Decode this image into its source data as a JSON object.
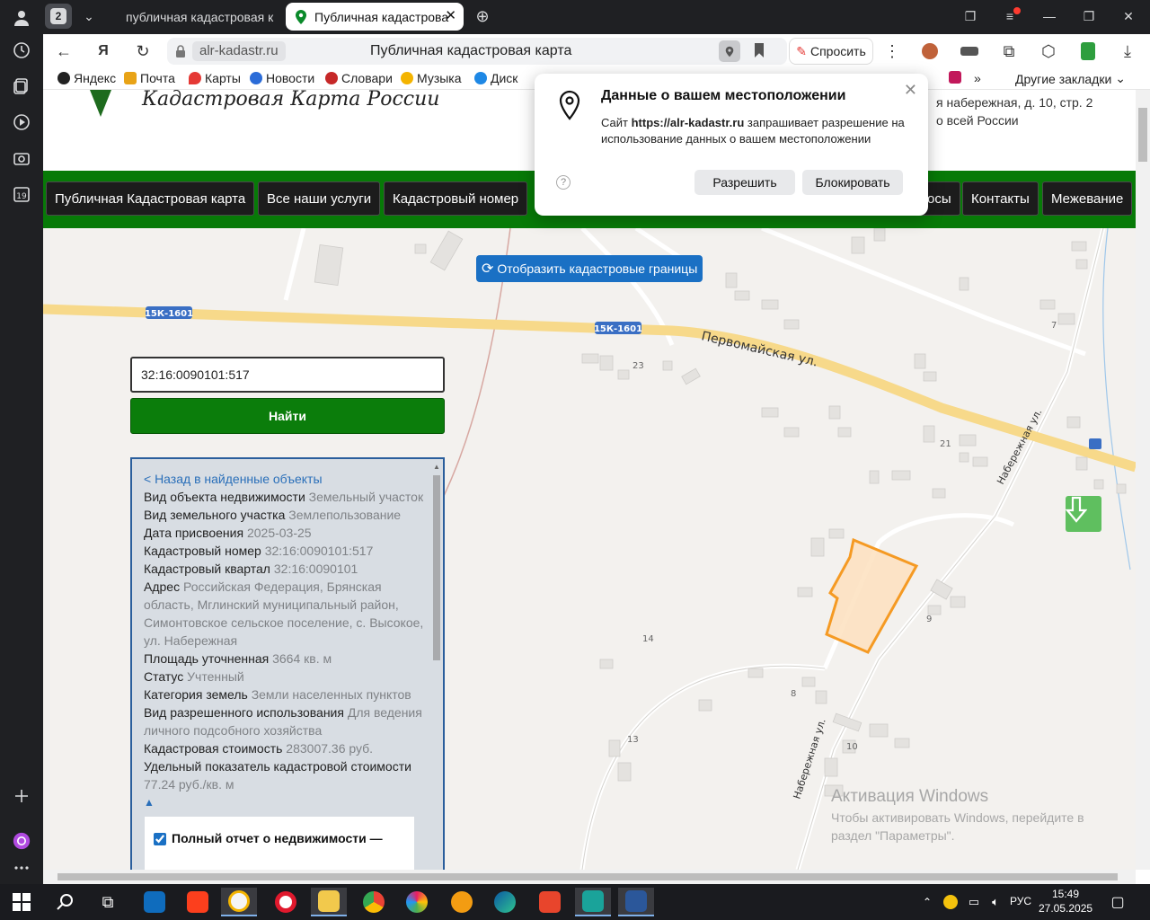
{
  "tabs": {
    "count": "2",
    "items": [
      {
        "label": "публичная кадастровая к"
      },
      {
        "label": "Публичная кадастрова"
      }
    ]
  },
  "address_bar": {
    "domain": "alr-kadastr.ru",
    "title": "Публичная кадастровая карта",
    "ask_label": "Спросить"
  },
  "bookmarks": {
    "items": [
      {
        "label": "Яндекс",
        "color": "#222222"
      },
      {
        "label": "Почта",
        "color": "#e8a317"
      },
      {
        "label": "Карты",
        "color": "#e53935"
      },
      {
        "label": "Новости",
        "color": "#2b6cd8"
      },
      {
        "label": "Словари",
        "color": "#c62828"
      },
      {
        "label": "Музыка",
        "color": "#f4b400"
      },
      {
        "label": "Диск",
        "color": "#1e88e5"
      }
    ],
    "other": "Другие закладки"
  },
  "site": {
    "title": "Кадастровая Карта России",
    "address_line1": "я набережная, д. 10, стр. 2",
    "address_line2": "о всей России"
  },
  "nav": [
    "Публичная Кадастровая карта",
    "Все наши услуги",
    "Кадастровый номер",
    "осы",
    "Контакты",
    "Межевание"
  ],
  "map": {
    "show_borders_label": "Отобразить кадастровые границы",
    "road_badge": "15К-1601",
    "street_pervomayskaya": "Первомайская ул.",
    "street_naberezhnaya": "Набережная ул.",
    "house_numbers": [
      "23",
      "7",
      "21",
      "9",
      "14",
      "8",
      "13",
      "10"
    ],
    "parcel_color": "#f59a23"
  },
  "search": {
    "value": "32:16:0090101:517",
    "button_label": "Найти"
  },
  "info": {
    "back_link": "< Назад в найденные объекты",
    "rows": [
      {
        "label": "Вид объекта недвижимости",
        "value": "Земельный участок"
      },
      {
        "label": "Вид земельного участка",
        "value": "Землепользование"
      },
      {
        "label": "Дата присвоения",
        "value": "2025-03-25"
      },
      {
        "label": "Кадастровый номер",
        "value": "32:16:0090101:517"
      },
      {
        "label": "Кадастровый квартал",
        "value": "32:16:0090101"
      },
      {
        "label": "Адрес",
        "value": "Российская Федерация, Брянская область, Мглинский муниципальный район, Симонтовское сельское поселение, с. Высокое, ул. Набережная"
      },
      {
        "label": "Площадь уточненная",
        "value": "3664 кв. м"
      },
      {
        "label": "Статус",
        "value": "Учтенный"
      },
      {
        "label": "Категория земель",
        "value": "Земли населенных пунктов"
      },
      {
        "label": "Вид разрешенного использования",
        "value": "Для ведения личного подсобного хозяйства"
      },
      {
        "label": "Кадастровая стоимость",
        "value": "283007.36 руб."
      },
      {
        "label": "Удельный показатель кадастровой стоимости",
        "value": "77.24 руб./кв. м"
      }
    ],
    "collapse_symbol": "▲",
    "report_label": "Полный отчет о недвижимости —"
  },
  "geo_popup": {
    "title": "Данные о вашем местоположении",
    "text_prefix": "Сайт ",
    "site": "https://alr-kadastr.ru",
    "text_suffix": " запрашивает разрешение на использование данных о вашем местоположении",
    "allow_label": "Разрешить",
    "block_label": "Блокировать",
    "help_symbol": "?"
  },
  "watermark": {
    "line1": "Активация Windows",
    "line2": "Чтобы активировать Windows, перейдите в раздел \"Параметры\"."
  },
  "taskbar": {
    "lang": "РУС",
    "time": "15:49",
    "date": "27.05.2025"
  }
}
